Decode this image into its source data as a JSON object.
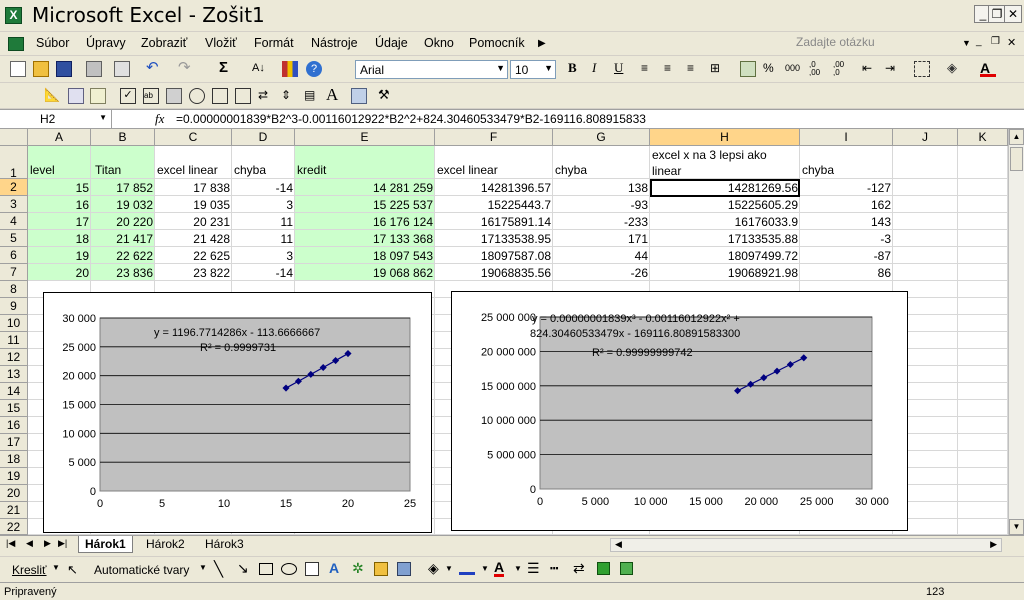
{
  "window": {
    "title": "Microsoft Excel - Zošit1",
    "app_icon_letter": "X"
  },
  "menu": {
    "items": [
      "Súbor",
      "Úpravy",
      "Zobraziť",
      "Vložiť",
      "Formát",
      "Nástroje",
      "Údaje",
      "Okno",
      "Pomocník"
    ],
    "help_placeholder": "Zadajte otázku"
  },
  "format": {
    "font": "Arial",
    "size": "10"
  },
  "formula_bar": {
    "name_box": "H2",
    "fx": "fx",
    "formula": "=0.00000001839*B2^3-0.00116012922*B2^2+824.30460533479*B2-169116.808915833"
  },
  "columns": [
    "A",
    "B",
    "C",
    "D",
    "E",
    "F",
    "G",
    "H",
    "I",
    "J",
    "K"
  ],
  "rows": [
    "1",
    "2",
    "3",
    "4",
    "5",
    "6",
    "7",
    "8",
    "9",
    "10",
    "11",
    "12",
    "13",
    "14",
    "15",
    "16",
    "17",
    "18",
    "19",
    "20",
    "21",
    "22"
  ],
  "headers": {
    "A": "level",
    "B": "Titan",
    "C": "excel linear",
    "D": "chyba",
    "E": "kredit",
    "F": "excel linear",
    "G": "chyba",
    "H": "excel x na 3 lepsi ako linear",
    "I": "chyba"
  },
  "table": [
    [
      "15",
      "17 852",
      "17 838",
      "-14",
      "14 281 259",
      "14281396.57",
      "138",
      "14281269.56",
      "-127"
    ],
    [
      "16",
      "19 032",
      "19 035",
      "3",
      "15 225 537",
      "15225443.7",
      "-93",
      "15225605.29",
      "162"
    ],
    [
      "17",
      "20 220",
      "20 231",
      "11",
      "16 176 124",
      "16175891.14",
      "-233",
      "16176033.9",
      "143"
    ],
    [
      "18",
      "21 417",
      "21 428",
      "11",
      "17 133 368",
      "17133538.95",
      "171",
      "17133535.88",
      "-3"
    ],
    [
      "19",
      "22 622",
      "22 625",
      "3",
      "18 097 543",
      "18097587.08",
      "44",
      "18097499.72",
      "-87"
    ],
    [
      "20",
      "23 836",
      "23 822",
      "-14",
      "19 068 862",
      "19068835.56",
      "-26",
      "19068921.98",
      "86"
    ]
  ],
  "chart_data": [
    {
      "type": "scatter",
      "x": [
        15,
        16,
        17,
        18,
        19,
        20
      ],
      "y": [
        17852,
        19032,
        20220,
        21417,
        22622,
        23836
      ],
      "xlim": [
        0,
        25
      ],
      "ylim": [
        0,
        30000
      ],
      "xticks": [
        "0",
        "5",
        "10",
        "15",
        "20",
        "25"
      ],
      "yticks": [
        "0",
        "5 000",
        "10 000",
        "15 000",
        "20 000",
        "25 000",
        "30 000"
      ],
      "trend_equation": "y = 1196.7714286x - 113.6666667",
      "r_squared": "R² = 0.9999731",
      "grid": true
    },
    {
      "type": "scatter",
      "x": [
        17852,
        19032,
        20220,
        21417,
        22622,
        23836
      ],
      "y": [
        14281259,
        15225537,
        16176124,
        17133368,
        18097543,
        19068862
      ],
      "xlim": [
        0,
        30000
      ],
      "ylim": [
        0,
        25000000
      ],
      "xticks": [
        "0",
        "5 000",
        "10 000",
        "15 000",
        "20 000",
        "25 000",
        "30 000"
      ],
      "yticks": [
        "0",
        "5 000 000",
        "10 000 000",
        "15 000 000",
        "20 000 000",
        "25 000 000"
      ],
      "trend_equation_1": "y = 0.00000001839x³ - 0.00116012922x² +",
      "trend_equation_2": "824.30460533479x - 169116.80891583300",
      "r_squared": "R² = 0.99999999742",
      "grid": true
    }
  ],
  "sheets": {
    "tabs": [
      "Hárok1",
      "Hárok2",
      "Hárok3"
    ],
    "active": "Hárok1"
  },
  "drawing": {
    "draw": "Kresliť",
    "autoshapes": "Automatické tvary"
  },
  "status": {
    "left": "Pripravený",
    "right": "123"
  }
}
